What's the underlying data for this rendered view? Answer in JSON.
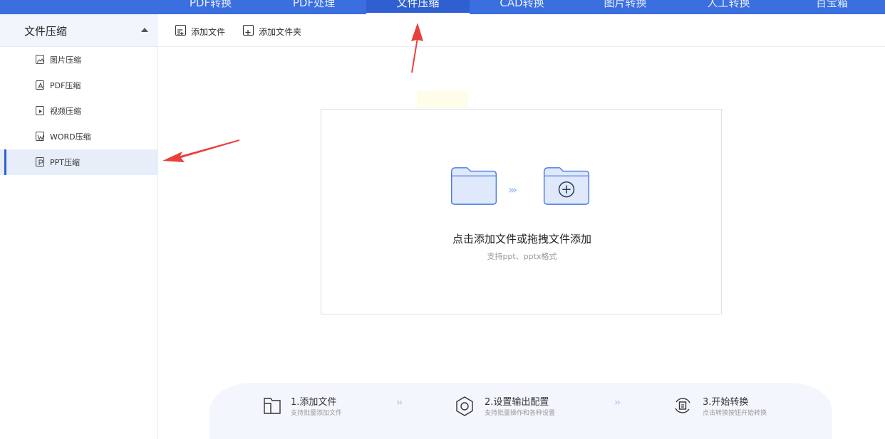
{
  "top_nav": {
    "tabs": [
      {
        "label": "PDF转换"
      },
      {
        "label": "PDF处理"
      },
      {
        "label": "文件压缩",
        "active": true
      },
      {
        "label": "CAD转换"
      },
      {
        "label": "图片转换"
      },
      {
        "label": "人工转换"
      },
      {
        "label": "百宝箱"
      }
    ]
  },
  "sidebar": {
    "title": "文件压缩",
    "items": [
      {
        "label": "图片压缩",
        "icon": "image-icon"
      },
      {
        "label": "PDF压缩",
        "icon": "pdf-icon"
      },
      {
        "label": "视频压缩",
        "icon": "video-icon"
      },
      {
        "label": "WORD压缩",
        "icon": "word-icon"
      },
      {
        "label": "PPT压缩",
        "icon": "ppt-icon",
        "active": true
      }
    ]
  },
  "toolbar": {
    "add_file": "添加文件",
    "add_folder": "添加文件夹"
  },
  "dropzone": {
    "main_text": "点击添加文件或拖拽文件添加",
    "sub_text": "支持ppt、pptx格式"
  },
  "steps": [
    {
      "title": "1.添加文件",
      "subtitle": "支持批量添加文件"
    },
    {
      "title": "2.设置输出配置",
      "subtitle": "支持批量操作和各种设置"
    },
    {
      "title": "3.开始转换",
      "subtitle": "点击转换按钮开始转换"
    }
  ],
  "colors": {
    "accent": "#3b6fe0",
    "annotation_arrow": "#e8403c",
    "folder_fill": "#dfe9fb",
    "folder_stroke": "#4a7be0"
  }
}
